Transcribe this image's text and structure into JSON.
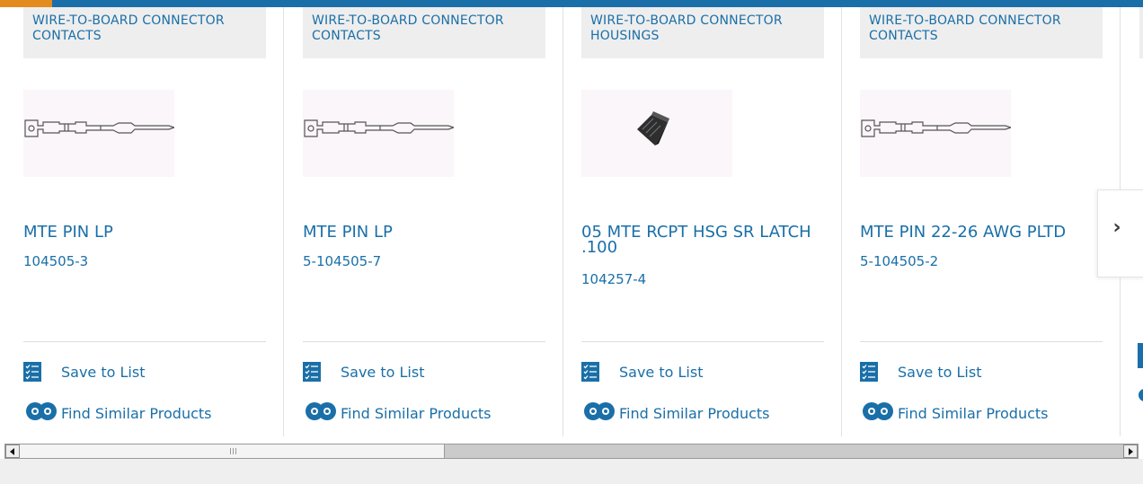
{
  "colors": {
    "accent": "#1a6fa8",
    "top_accent": "#e38b1f",
    "category_bg": "#eeeeee"
  },
  "cards": [
    {
      "category": "WIRE-TO-BOARD CONNECTOR CONTACTS",
      "name": "MTE PIN LP",
      "part": "104505-3",
      "save_label": "Save to List",
      "similar_label": "Find Similar Products",
      "image": "contact-pin"
    },
    {
      "category": "WIRE-TO-BOARD CONNECTOR CONTACTS",
      "name": "MTE PIN LP",
      "part": "5-104505-7",
      "save_label": "Save to List",
      "similar_label": "Find Similar Products",
      "image": "contact-pin"
    },
    {
      "category": "WIRE-TO-BOARD CONNECTOR HOUSINGS",
      "name": "05 MTE RCPT HSG SR LATCH .100",
      "part": "104257-4",
      "save_label": "Save to List",
      "similar_label": "Find Similar Products",
      "image": "connector-housing"
    },
    {
      "category": "WIRE-TO-BOARD CONNECTOR CONTACTS",
      "name": "MTE PIN 22-26 AWG PLTD",
      "part": "5-104505-2",
      "save_label": "Save to List",
      "similar_label": "Find Similar Products",
      "image": "contact-pin"
    }
  ],
  "carousel": {
    "next_icon": "chevron-right-icon"
  },
  "scrollbar": {
    "left_icon": "arrow-left-icon",
    "right_icon": "arrow-right-icon"
  }
}
